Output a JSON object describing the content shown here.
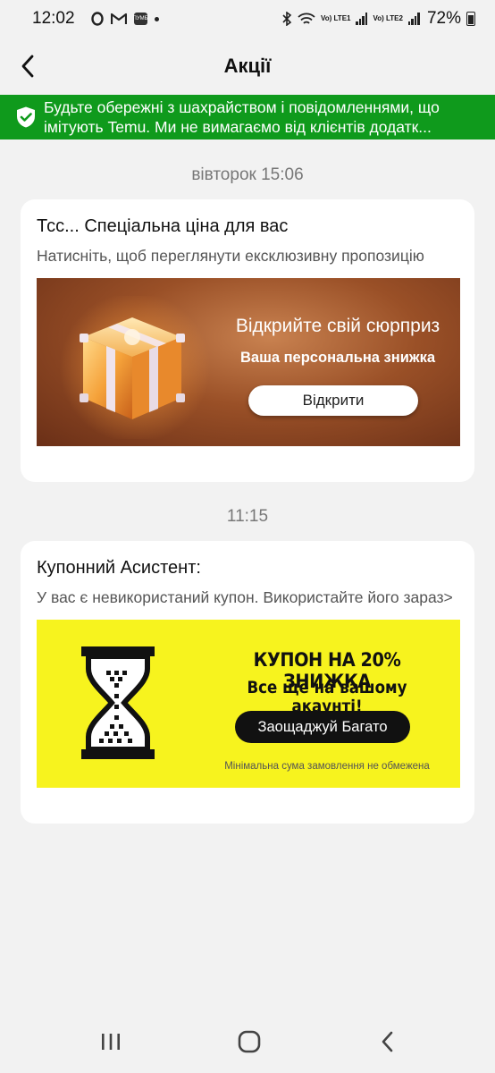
{
  "status_bar": {
    "time": "12:02",
    "app_badge": "ПУМБ",
    "lte1": "Vo) LTE1",
    "lte2": "Vo) LTE2",
    "battery": "72%"
  },
  "header": {
    "title": "Акції",
    "back_icon": "chevron-left-icon"
  },
  "warning": {
    "text": "Будьте обережні з шахрайством і повідомленнями, що імітують Temu. Ми не вимагаємо від клієнтів додатк...",
    "icon": "shield-check-icon",
    "color": "#0f9a1c"
  },
  "messages": [
    {
      "timestamp": "вівторок 15:06",
      "title": "Тсс... Спеціальна ціна для вас",
      "subtitle": "Натисніть, щоб переглянути ексклюзивну пропозицію",
      "banner": {
        "title": "Відкрийте свій сюрприз",
        "subtitle": "Ваша персональна знижка",
        "button": "Відкрити",
        "icon": "gift-box-icon"
      }
    },
    {
      "timestamp": "11:15",
      "title": "Купонний Асистент:",
      "subtitle": "У вас є невикористаний купон. Використайте його зараз>",
      "banner": {
        "title": "КУПОН НА 20% ЗНИЖКА",
        "subtitle": "Все ще на вашому акаунті!",
        "button": "Заощаджуй Багато",
        "note": "Мінімальна сума замовлення не обмежена",
        "icon": "hourglass-icon",
        "color": "#f7f31e"
      }
    }
  ],
  "nav_bar": {
    "recents_icon": "recent-apps-icon",
    "home_icon": "home-icon",
    "back_icon": "back-icon"
  }
}
